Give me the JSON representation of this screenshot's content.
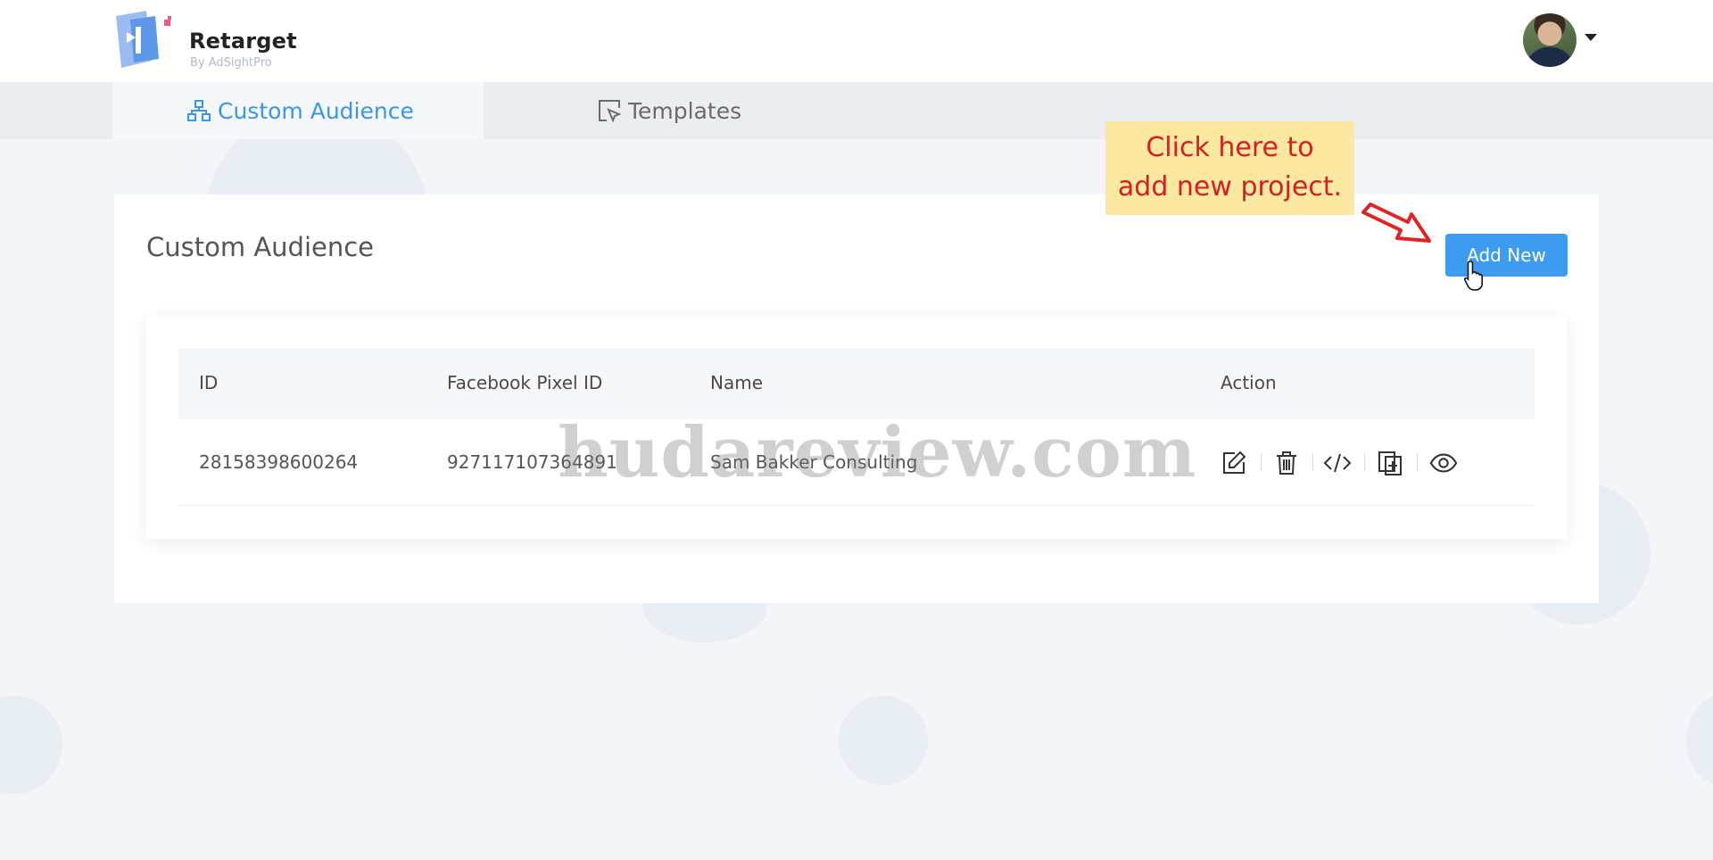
{
  "header": {
    "brand_title": "Retarget",
    "brand_subtitle": "By AdSightPro",
    "avatar_icon": "user-avatar",
    "menu_caret_icon": "caret-down-icon"
  },
  "tabs": [
    {
      "label": "Custom Audience",
      "icon": "sitemap-icon",
      "active": true
    },
    {
      "label": "Templates",
      "icon": "template-select-icon",
      "active": false
    }
  ],
  "main": {
    "title": "Custom Audience",
    "add_button_label": "Add New"
  },
  "callout": {
    "line1": "Click here to",
    "line2": "add new project."
  },
  "table": {
    "columns": [
      "ID",
      "Facebook Pixel ID",
      "Name",
      "Action"
    ],
    "rows": [
      {
        "id": "28158398600264",
        "pixel_id": "927117107364891",
        "name": "Sam Bakker Consulting",
        "actions": [
          "edit-icon",
          "trash-icon",
          "code-icon",
          "copy-icon",
          "eye-icon"
        ]
      }
    ]
  },
  "watermark": "hudareview.com",
  "colors": {
    "accent": "#3d9bf0",
    "active_tab": "#3a96e6",
    "callout_bg": "#fce9a1",
    "callout_text": "#d71f1f"
  }
}
